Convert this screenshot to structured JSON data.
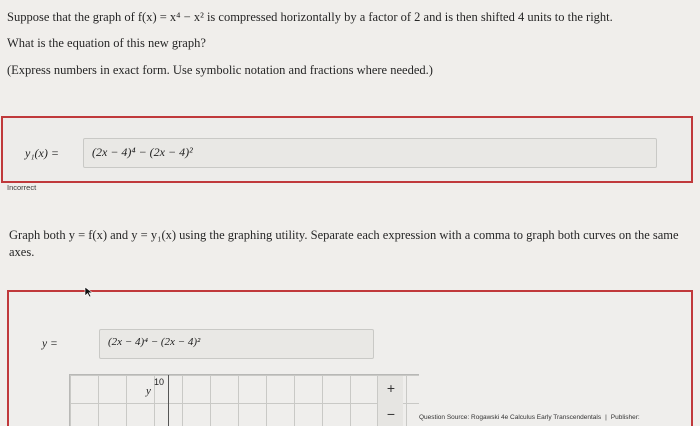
{
  "question": {
    "line1": "Suppose that the graph of f(x) = x⁴ − x² is compressed horizontally by a factor of 2 and is then shifted 4 units to the right.",
    "line2": "What is the equation of this new graph?",
    "line3": "(Express numbers in exact form. Use symbolic notation and fractions where needed.)"
  },
  "answer": {
    "label": "y₁(x) =",
    "value": "(2x − 4)⁴ − (2x − 4)²"
  },
  "status": "Incorrect",
  "graph_instructions": "Graph both y = f(x) and y = y₁(x) using the graphing utility. Separate each expression with a comma to graph both curves on the same axes.",
  "graph": {
    "eq_label": "y =",
    "eq_value": "(2x − 4)⁴ − (2x − 4)²",
    "tick_label": "10",
    "axis_label": "y",
    "zoom_in": "+",
    "zoom_out": "−"
  },
  "source": {
    "text": "Question Source: Rogawski 4e Calculus Early Transcendentals",
    "sep": "|",
    "publisher": "Publisher:"
  },
  "colors": {
    "incorrect_border": "#c0393b"
  }
}
